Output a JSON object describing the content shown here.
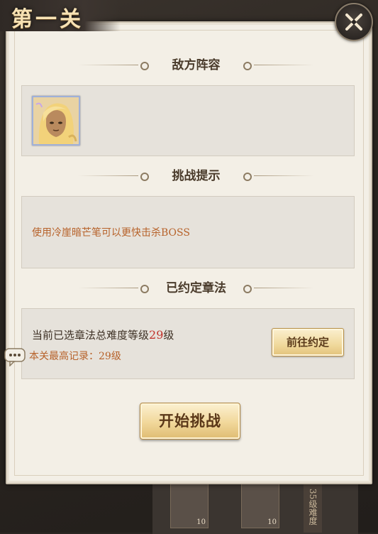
{
  "level": {
    "title": "第一关"
  },
  "sections": {
    "enemy": {
      "heading": "敌方阵容"
    },
    "hint": {
      "heading": "挑战提示",
      "text": "使用冷崖暗芒笔可以更快击杀BOSS"
    },
    "pact": {
      "heading": "已约定章法",
      "difficulty_prefix": "当前已选章法总难度等级",
      "difficulty_level": "29",
      "difficulty_suffix": "级",
      "record": "本关最高记录：29级",
      "goto_label": "前往约定"
    }
  },
  "start_button": {
    "label": "开始挑战"
  },
  "background": {
    "slot_counts": [
      "10",
      "10"
    ],
    "side_label": "35级难度"
  },
  "colors": {
    "accent_gold": "#f0d99c",
    "highlight_red": "#c0302a",
    "hint_orange": "#b7622a"
  },
  "icons": [
    "close-icon",
    "chat-bubble-icon",
    "enemy-avatar"
  ]
}
